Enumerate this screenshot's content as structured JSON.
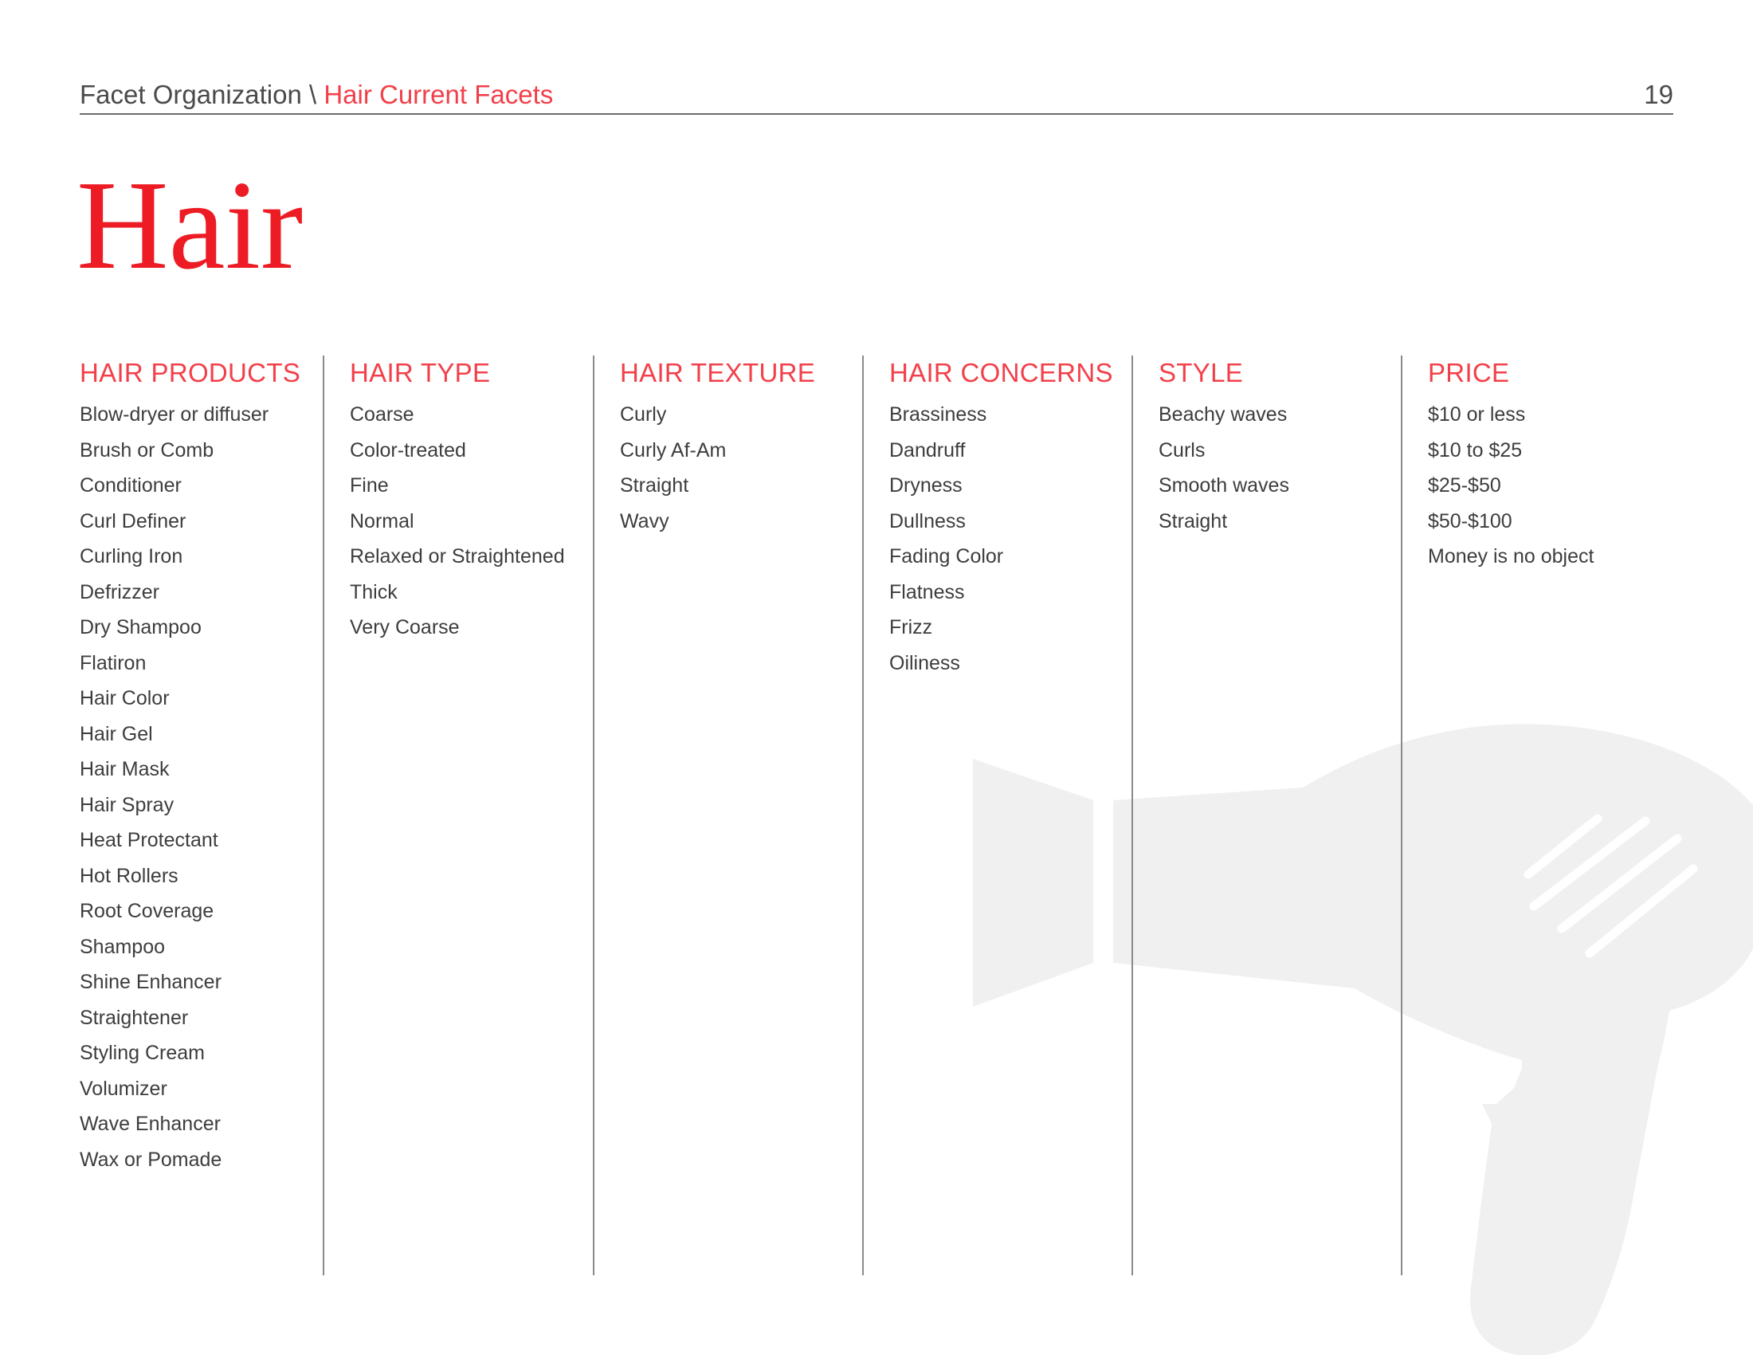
{
  "header": {
    "breadcrumb_root": "Facet Organization",
    "breadcrumb_separator": " \\ ",
    "breadcrumb_current": "Hair Current Facets",
    "page_number": "19"
  },
  "title": "Hair",
  "columns": [
    {
      "heading": "HAIR PRODUCTS",
      "items": [
        "Blow-dryer or diffuser",
        "Brush or Comb",
        "Conditioner",
        "Curl Definer",
        "Curling Iron",
        "Defrizzer",
        "Dry Shampoo",
        "Flatiron",
        "Hair Color",
        "Hair Gel",
        "Hair Mask",
        "Hair Spray",
        "Heat Protectant",
        "Hot Rollers",
        "Root Coverage",
        "Shampoo",
        "Shine Enhancer",
        "Straightener",
        "Styling Cream",
        "Volumizer",
        "Wave Enhancer",
        "Wax or Pomade"
      ]
    },
    {
      "heading": "HAIR TYPE",
      "items": [
        "Coarse",
        "Color-treated",
        "Fine",
        "Normal",
        "Relaxed or Straightened",
        "Thick",
        "Very Coarse"
      ]
    },
    {
      "heading": "HAIR TEXTURE",
      "items": [
        "Curly",
        "Curly Af-Am",
        "Straight",
        "Wavy"
      ]
    },
    {
      "heading": "HAIR CONCERNS",
      "items": [
        "Brassiness",
        "Dandruff",
        "Dryness",
        "Dullness",
        "Fading Color",
        "Flatness",
        "Frizz",
        "Oiliness"
      ]
    },
    {
      "heading": "STYLE",
      "items": [
        "Beachy waves",
        "Curls",
        "Smooth waves",
        "Straight"
      ]
    },
    {
      "heading": "PRICE",
      "items": [
        "$10 or less",
        "$10 to $25",
        "$25-$50",
        "$50-$100",
        "Money is no object"
      ]
    }
  ],
  "illustration": {
    "icon": "hair-dryer-icon",
    "color": "#f0f0f0"
  },
  "colors": {
    "accent": "#ed1c24",
    "text": "#3d3d3d",
    "rule": "#8a8a8a"
  }
}
